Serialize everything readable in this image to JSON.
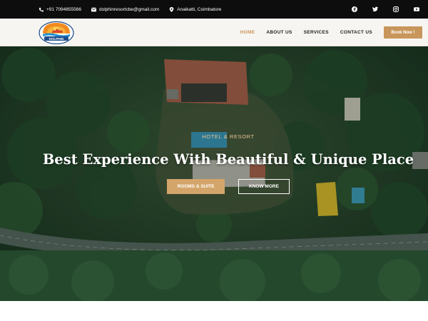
{
  "topbar": {
    "phone": "+91 7094855566",
    "email": "dolphinresortcbe@gmail.com",
    "location": "Anaikatti, Coimbatore",
    "social_icons": [
      "facebook-icon",
      "twitter-icon",
      "instagram-icon",
      "youtube-icon"
    ]
  },
  "header": {
    "logo_text": "DOLPHIN",
    "nav": [
      "HOME",
      "ABOUT US",
      "SERVICES",
      "CONTACT US"
    ],
    "active_nav": "HOME",
    "book_label": "Book Now !"
  },
  "hero": {
    "eyebrow": "HOTEL & RESORT",
    "headline": "Best Experience With Beautiful & Unique Place",
    "primary_button": "ROOMS & SUITE",
    "secondary_button": "KNOW MORE"
  },
  "colors": {
    "accent": "#c8965a",
    "topbar": "#0d0d0d",
    "header_bg": "#f7f5f1"
  }
}
